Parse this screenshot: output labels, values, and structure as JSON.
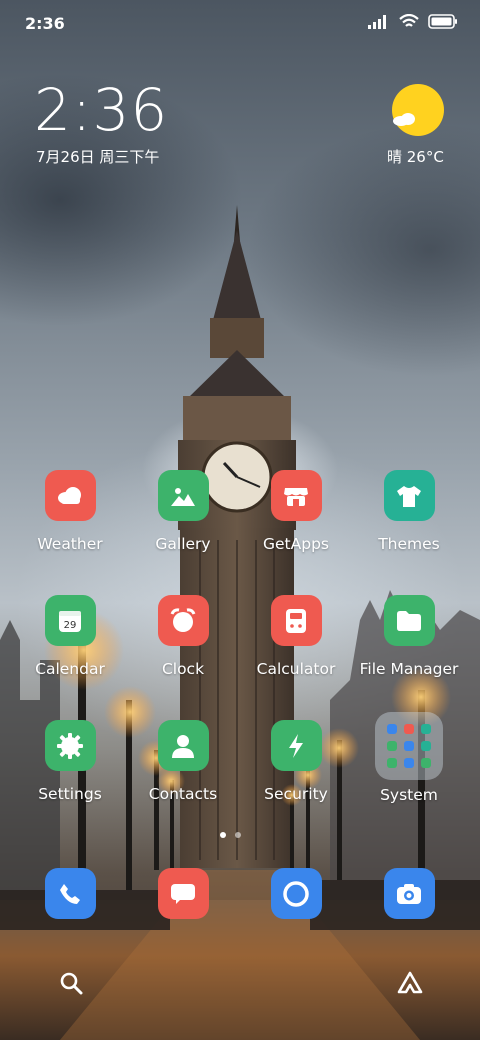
{
  "status_bar": {
    "time": "2:36",
    "icons": [
      "signal-icon",
      "wifi-icon",
      "battery-icon"
    ]
  },
  "clock_widget": {
    "time": "2:36",
    "date": "7月26日 周三下午"
  },
  "weather_widget": {
    "condition_icon": "sun-cloud-icon",
    "text": "晴 26°C"
  },
  "apps": [
    {
      "label": "Weather",
      "icon": "cloud-icon",
      "color": "#ef5a50"
    },
    {
      "label": "Gallery",
      "icon": "image-icon",
      "color": "#3db36b"
    },
    {
      "label": "GetApps",
      "icon": "store-icon",
      "color": "#ef5a50"
    },
    {
      "label": "Themes",
      "icon": "shirt-icon",
      "color": "#26b195"
    },
    {
      "label": "Calendar",
      "icon": "calendar-icon",
      "color": "#3db36b",
      "badge": "29"
    },
    {
      "label": "Clock",
      "icon": "alarm-clock-icon",
      "color": "#ef5a50"
    },
    {
      "label": "Calculator",
      "icon": "calculator-icon",
      "color": "#ef5a50"
    },
    {
      "label": "File Manager",
      "icon": "folder-icon",
      "color": "#3db36b"
    },
    {
      "label": "Settings",
      "icon": "gear-icon",
      "color": "#3db36b"
    },
    {
      "label": "Contacts",
      "icon": "person-icon",
      "color": "#3db36b"
    },
    {
      "label": "Security",
      "icon": "lightning-icon",
      "color": "#3db36b"
    },
    {
      "label": "System",
      "icon": "folder-grid-icon",
      "color": "#c8d2dc"
    }
  ],
  "dock": [
    {
      "name": "phone",
      "icon": "phone-icon",
      "color": "#3a86ec"
    },
    {
      "name": "messaging",
      "icon": "message-icon",
      "color": "#ef5a50"
    },
    {
      "name": "browser",
      "icon": "browser-circle-icon",
      "color": "#3a86ec"
    },
    {
      "name": "camera",
      "icon": "camera-icon",
      "color": "#3a86ec"
    }
  ],
  "page_indicator": {
    "pages": 2,
    "current": 1
  },
  "bottom_bar": [
    "search-icon",
    "app-vault-icon"
  ]
}
